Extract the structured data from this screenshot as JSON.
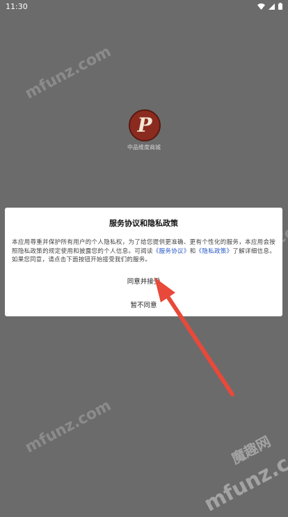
{
  "status_bar": {
    "time": "11:30",
    "icons": [
      "wifi-icon",
      "cellular-signal-icon",
      "battery-icon"
    ]
  },
  "app": {
    "logo_glyph": "P",
    "name": "中品维度商城"
  },
  "dialog": {
    "title": "服务协议和隐私政策",
    "body_prefix": "本应用尊重并保护所有用户的个人隐私权，为了给您提供更准确、更有个性化的服务，本应用会按照隐私政策的规定使用和披露您的个人信息。可阅读",
    "service_link": "《服务协议》",
    "and_text": "和",
    "privacy_link": "《隐私政策》",
    "body_suffix": "了解详细信息。如果您同意，请点击下面按钮开始接受我们的服务。",
    "agree_button": "同意并接受",
    "disagree_button": "暂不同意"
  },
  "watermarks": {
    "text": "mfunz.com",
    "brand": "魔趣网"
  },
  "colors": {
    "overlay": "#6b6b6b",
    "link": "#2757c6",
    "arrow": "#e8493a",
    "logo": "#8b2b1f"
  }
}
